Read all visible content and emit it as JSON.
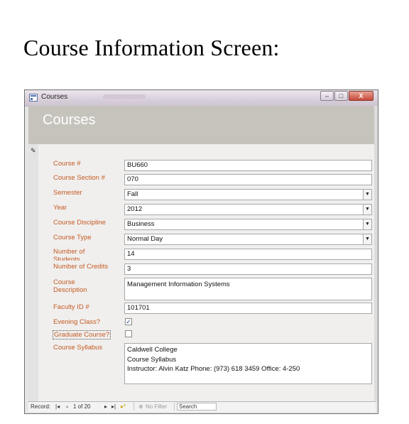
{
  "heading": "Course Information Screen:",
  "window": {
    "title": "Courses",
    "buttons": {
      "minimize": "–",
      "maximize": "□",
      "close": "X"
    }
  },
  "form": {
    "title": "Courses",
    "fields": {
      "course_num": {
        "label": "Course #",
        "value": "BU660"
      },
      "section": {
        "label": "Course Section #",
        "value": "070"
      },
      "semester": {
        "label": "Semester",
        "value": "Fall"
      },
      "year": {
        "label": "Year",
        "value": "2012"
      },
      "discipline": {
        "label": "Course Discipline",
        "value": "Business"
      },
      "type": {
        "label": "Course Type",
        "value": "Normal Day"
      },
      "num_students": {
        "label": "Number of Students",
        "value": "14"
      },
      "num_credits": {
        "label": "Number of Credits",
        "value": "3"
      },
      "description": {
        "label": "Course Description",
        "value": "Management Information Systems"
      },
      "faculty_id": {
        "label": "Faculty ID #",
        "value": "101701"
      },
      "evening": {
        "label": "Evening Class?",
        "checked": true
      },
      "graduate": {
        "label": "Graduate Course?",
        "checked": false
      },
      "syllabus": {
        "label": "Course Syllabus",
        "value": "Caldwell College\nCourse Syllabus\nInstructor: Alvin Katz Phone: (973) 618 3459 Office: 4-250"
      }
    }
  },
  "navigation": {
    "record_label": "Record:",
    "first": "|◂",
    "prev": "◂",
    "position": "1 of 20",
    "next": "▸",
    "last": "▸|",
    "new_record": "▸*",
    "filter_icon": "⊗",
    "filter_label": "No Filter",
    "search_placeholder": "Search",
    "checkmark": "✓",
    "dropdown_glyph": "▼",
    "edit_glyph": "✎"
  }
}
